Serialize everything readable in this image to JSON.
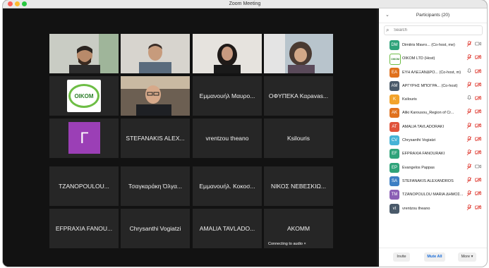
{
  "window": {
    "title": "Zoom Meeting"
  },
  "video": {
    "tiles": [
      {
        "name": "",
        "kind": "camera",
        "scene": "man-beard"
      },
      {
        "name": "",
        "kind": "camera",
        "scene": "man-shirt"
      },
      {
        "name": "",
        "kind": "camera",
        "scene": "woman-dark",
        "talking": true
      },
      {
        "name": "",
        "kind": "camera",
        "scene": "person-curly"
      },
      {
        "name": "",
        "kind": "logo",
        "logo_text": "OIKOM"
      },
      {
        "name": "",
        "kind": "camera",
        "scene": "man-glasses"
      },
      {
        "name": "Εμμανουήλ Μαυρο...",
        "kind": "name"
      },
      {
        "name": "ΟΦΥΠΕΚΑ Καρavas...",
        "kind": "name"
      },
      {
        "name": "",
        "kind": "avatar",
        "avatar_letter": "Γ"
      },
      {
        "name": "STEFANAKIS ALEX...",
        "kind": "name"
      },
      {
        "name": "vrentzou theano",
        "kind": "name"
      },
      {
        "name": "Ksilouris",
        "kind": "name"
      },
      {
        "name": "TZANOPOULOU...",
        "kind": "name"
      },
      {
        "name": "Τσαγκαράκη Όλγα...",
        "kind": "name"
      },
      {
        "name": "Εμμανουήλ. Κοκοσ...",
        "kind": "name"
      },
      {
        "name": "ΝΙΚΟΣ ΝΕΒΕΣΚΙΩ...",
        "kind": "name"
      },
      {
        "name": "EFPRAXIA FANOU...",
        "kind": "name"
      },
      {
        "name": "Chrysanthi Vogiatzi",
        "kind": "name"
      },
      {
        "name": "AMALIA TAVLADO...",
        "kind": "name"
      },
      {
        "name": "AKOMM",
        "kind": "name",
        "note": "Connecting to audio",
        "note_icon": "×"
      }
    ]
  },
  "participants": {
    "title": "Participants (20)",
    "search_placeholder": "Search",
    "list": [
      {
        "initials": "DM",
        "name": "Dimitris Mavro...  (Co-host, me)",
        "color": "#2fa37a",
        "mic": "red",
        "cam": "grey"
      },
      {
        "initials": "OIKOM",
        "name": "OIKOM LTD (Host)",
        "color": "#ffffff",
        "mic": "red",
        "cam": "red",
        "logo": true
      },
      {
        "initials": "ΕΑ",
        "name": "ΕΥΗ ΑΛΕΞΑΝΔΡΟ...  (Co-host, m)",
        "color": "#e0711d",
        "mic": "grey",
        "cam": "red"
      },
      {
        "initials": "ΑΜ",
        "name": "ΑΡΓΥΡΗΣ ΜΠΟΓΡΑ...  (Co-host)",
        "color": "#4a5a6a",
        "mic": "red",
        "cam": "red"
      },
      {
        "initials": "K",
        "name": "Ksilouris",
        "color": "#f2a32b",
        "mic": "grey",
        "cam": "red"
      },
      {
        "initials": "AK",
        "name": "Aliki Karousou_Region of Cr...",
        "color": "#e0711d",
        "mic": "red",
        "cam": "red"
      },
      {
        "initials": "AT",
        "name": "AMALIA TAVLADORAKI",
        "color": "#e0533b",
        "mic": "red",
        "cam": "red"
      },
      {
        "initials": "CV",
        "name": "Chrysanthi Vogiatzi",
        "color": "#45b3d6",
        "mic": "red",
        "cam": "red"
      },
      {
        "initials": "EF",
        "name": "EFPRAXIA FANOURAKI",
        "color": "#2fa37a",
        "mic": "red",
        "cam": "red"
      },
      {
        "initials": "EP",
        "name": "Evangelos Pappas",
        "color": "#2fa37a",
        "mic": "red",
        "cam": "grey"
      },
      {
        "initials": "SA",
        "name": "STEFANAKIS ALEXANDROS",
        "color": "#3d7fc4",
        "mic": "red",
        "cam": "red"
      },
      {
        "initials": "TM",
        "name": "TZANOPOULOU MARIA ΔΗΜΟΣ...",
        "color": "#8b5fb5",
        "mic": "red",
        "cam": "red"
      },
      {
        "initials": "vt",
        "name": "vrentzou theano",
        "color": "#4a5a6a",
        "mic": "red",
        "cam": "red"
      }
    ]
  },
  "footer": {
    "invite_label": "Invite",
    "mute_all_label": "Mute All",
    "more_label": "More ▾"
  },
  "colors": {
    "talking_border": "#25c36b",
    "muted": "#e0443b",
    "accent": "#1a6dd9"
  },
  "icons": {
    "mic": "microphone-icon",
    "cam": "camera-icon",
    "search": "search-icon"
  }
}
